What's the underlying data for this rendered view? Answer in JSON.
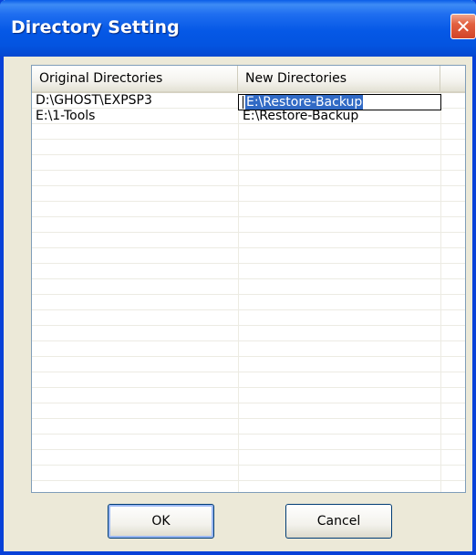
{
  "window": {
    "title": "Directory Setting",
    "close_glyph": "✕"
  },
  "listview": {
    "columns": [
      "Original Directories",
      "New Directories",
      ""
    ],
    "rows": [
      {
        "original": "D:\\GHOST\\EXPSP3",
        "new": "E:\\Restore-Backup",
        "editing": true
      },
      {
        "original": "E:\\1-Tools",
        "new": "E:\\Restore-Backup",
        "editing": false
      }
    ],
    "empty_rows": 24
  },
  "buttons": {
    "ok_label": "OK",
    "cancel_label": "Cancel"
  },
  "colors": {
    "titlebar": "#0558e6",
    "selection": "#316ac5",
    "dialog_bg": "#ece9d8"
  }
}
